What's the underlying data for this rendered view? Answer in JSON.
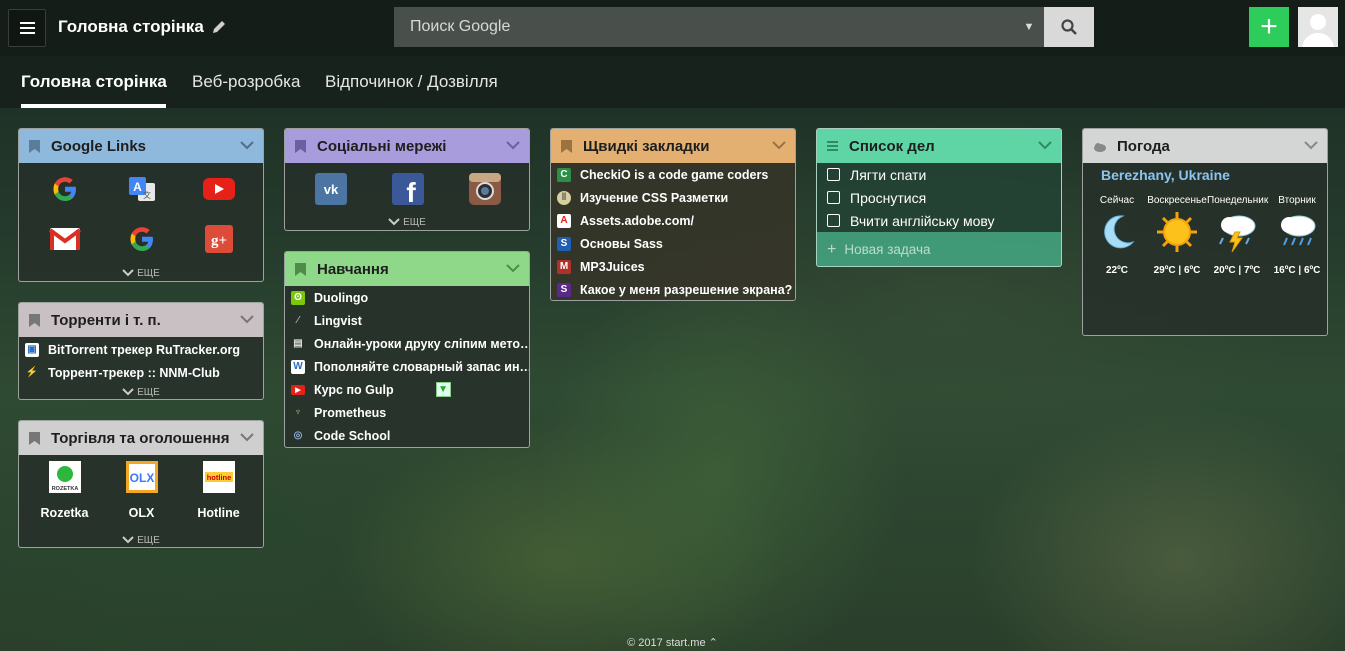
{
  "header": {
    "title": "Головна сторінка",
    "search_placeholder": "Поиск Google"
  },
  "tabs": [
    {
      "label": "Головна сторінка"
    },
    {
      "label": "Веб-розробка"
    },
    {
      "label": "Відпочинок / Дозвілля"
    }
  ],
  "colors": {
    "google_links": "#8fb8dd",
    "social": "#a89cdc",
    "quick": "#e3b071",
    "todo": "#5fd5a5",
    "weather": "#d4d6d5",
    "torrents": "#c9c0c4",
    "trade": "#cfcfcf",
    "learning": "#8fd88a",
    "add_button": "#2ecc5a"
  },
  "widgets": {
    "google_links": {
      "title": "Google Links",
      "more": "ЕЩЕ",
      "icons": [
        "google-icon",
        "google-translate-icon",
        "youtube-icon",
        "gmail-icon",
        "google-icon",
        "google-plus-icon"
      ]
    },
    "torrents": {
      "title": "Торренти і т. п.",
      "more": "ЕЩЕ",
      "links": [
        "BitTorrent трекер RuTracker.org",
        "Торрент-трекер :: NNM-Club"
      ]
    },
    "trade": {
      "title": "Торгівля та оголошення",
      "more": "ЕЩЕ",
      "items": [
        "Rozetka",
        "OLX",
        "Hotline"
      ]
    },
    "social": {
      "title": "Соціальні мережі",
      "more": "ЕЩЕ",
      "icons": [
        "vk-icon",
        "facebook-icon",
        "instagram-icon"
      ]
    },
    "learning": {
      "title": "Навчання",
      "links": [
        "Duolingo",
        "Lingvist",
        "Онлайн-уроки друку сліпим мето…",
        "Пополняйте словарный запас ин…",
        "Курс по Gulp",
        "Prometheus",
        "Code School"
      ]
    },
    "quick": {
      "title": "Щвидкі закладки",
      "links": [
        "CheckiO is a code game coders",
        "Изучение CSS Разметки",
        "Assets.adobe.com/",
        "Основы Sass",
        "MP3Juices",
        "Какое у меня разрешение экрана?"
      ]
    },
    "todo": {
      "title": "Список дел",
      "items": [
        "Лягти спати",
        "Проснутися",
        "Вчити англійську мову"
      ],
      "new_task": "Новая задача"
    },
    "weather": {
      "title": "Погода",
      "location": "Berezhany, Ukraine",
      "days": [
        {
          "label": "Сейчас",
          "temp": "22ºC",
          "icon": "moon-icon"
        },
        {
          "label": "Воскресенье",
          "temp": "29ºC | 6ºC",
          "icon": "sun-icon"
        },
        {
          "label": "Понедельник",
          "temp": "20ºC | 7ºC",
          "icon": "thunderstorm-icon"
        },
        {
          "label": "Вторник",
          "temp": "16ºC | 6ºC",
          "icon": "rain-icon"
        }
      ]
    }
  },
  "footer": {
    "text": "© 2017 start.me"
  }
}
